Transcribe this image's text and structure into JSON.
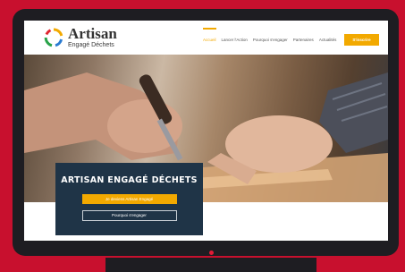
{
  "site": {
    "logo_name": "Artisan",
    "logo_tagline": "Engagé Déchets"
  },
  "nav": {
    "items": [
      {
        "label": "Accueil",
        "active": true
      },
      {
        "label": "Lancer l'Action",
        "active": false
      },
      {
        "label": "Pourquoi s'engager",
        "active": false
      },
      {
        "label": "Partenaires",
        "active": false
      },
      {
        "label": "Actualités",
        "active": false
      }
    ],
    "cta_label": "S'inscrire"
  },
  "hero": {
    "title": "ARTISAN ENGAGÉ DÉCHETS",
    "primary_button": "Je deviens Artisan Engagé",
    "secondary_button": "Pourquoi s'engager"
  },
  "colors": {
    "frame": "#c8102e",
    "monitor": "#1e1d22",
    "accent": "#f2a900",
    "card": "#1f3447"
  }
}
